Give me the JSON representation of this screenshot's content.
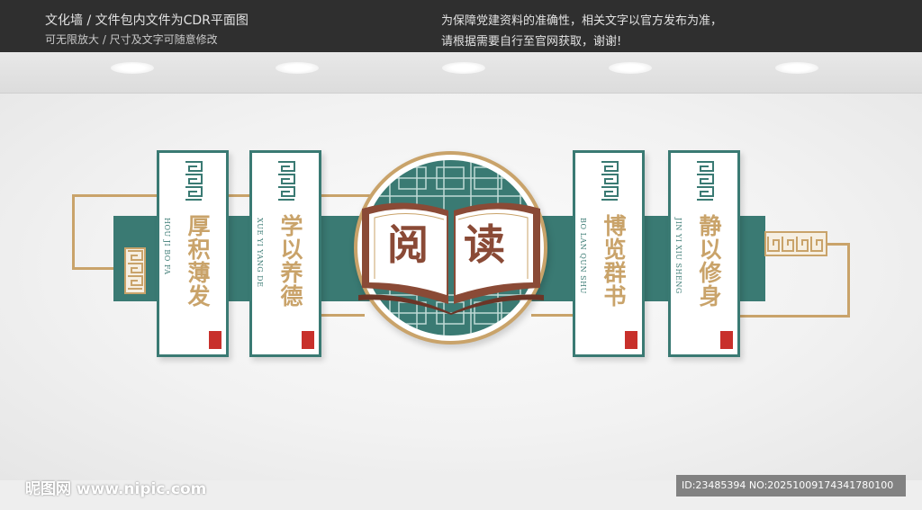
{
  "header": {
    "line1_left": "文化墙 / 文件包内文件为CDR平面图",
    "line2_left": "可无限放大 / 尺寸及文字可随意修改",
    "line1_right": "为保障党建资料的准确性，相关文字以官方发布为准，",
    "line2_right": "请根据需要自行至官网获取，谢谢!"
  },
  "center": {
    "char_left": "阅",
    "char_right": "读"
  },
  "panels": [
    {
      "title": "厚积薄发",
      "pinyin": "HOU JI BO FA"
    },
    {
      "title": "学以养德",
      "pinyin": "XUE YI YANG DE"
    },
    {
      "title": "博览群书",
      "pinyin": "BO LAN QUN SHU"
    },
    {
      "title": "静以修身",
      "pinyin": "JIN YI XIU SHENG"
    }
  ],
  "watermark": {
    "site": "昵图网 www.nipic.com",
    "id_text": "ID:23485394 NO:20251009174341780100"
  },
  "colors": {
    "teal": "#3a7a73",
    "gold": "#c9a36a",
    "brown": "#8a4a36",
    "seal_red": "#c8302b"
  }
}
